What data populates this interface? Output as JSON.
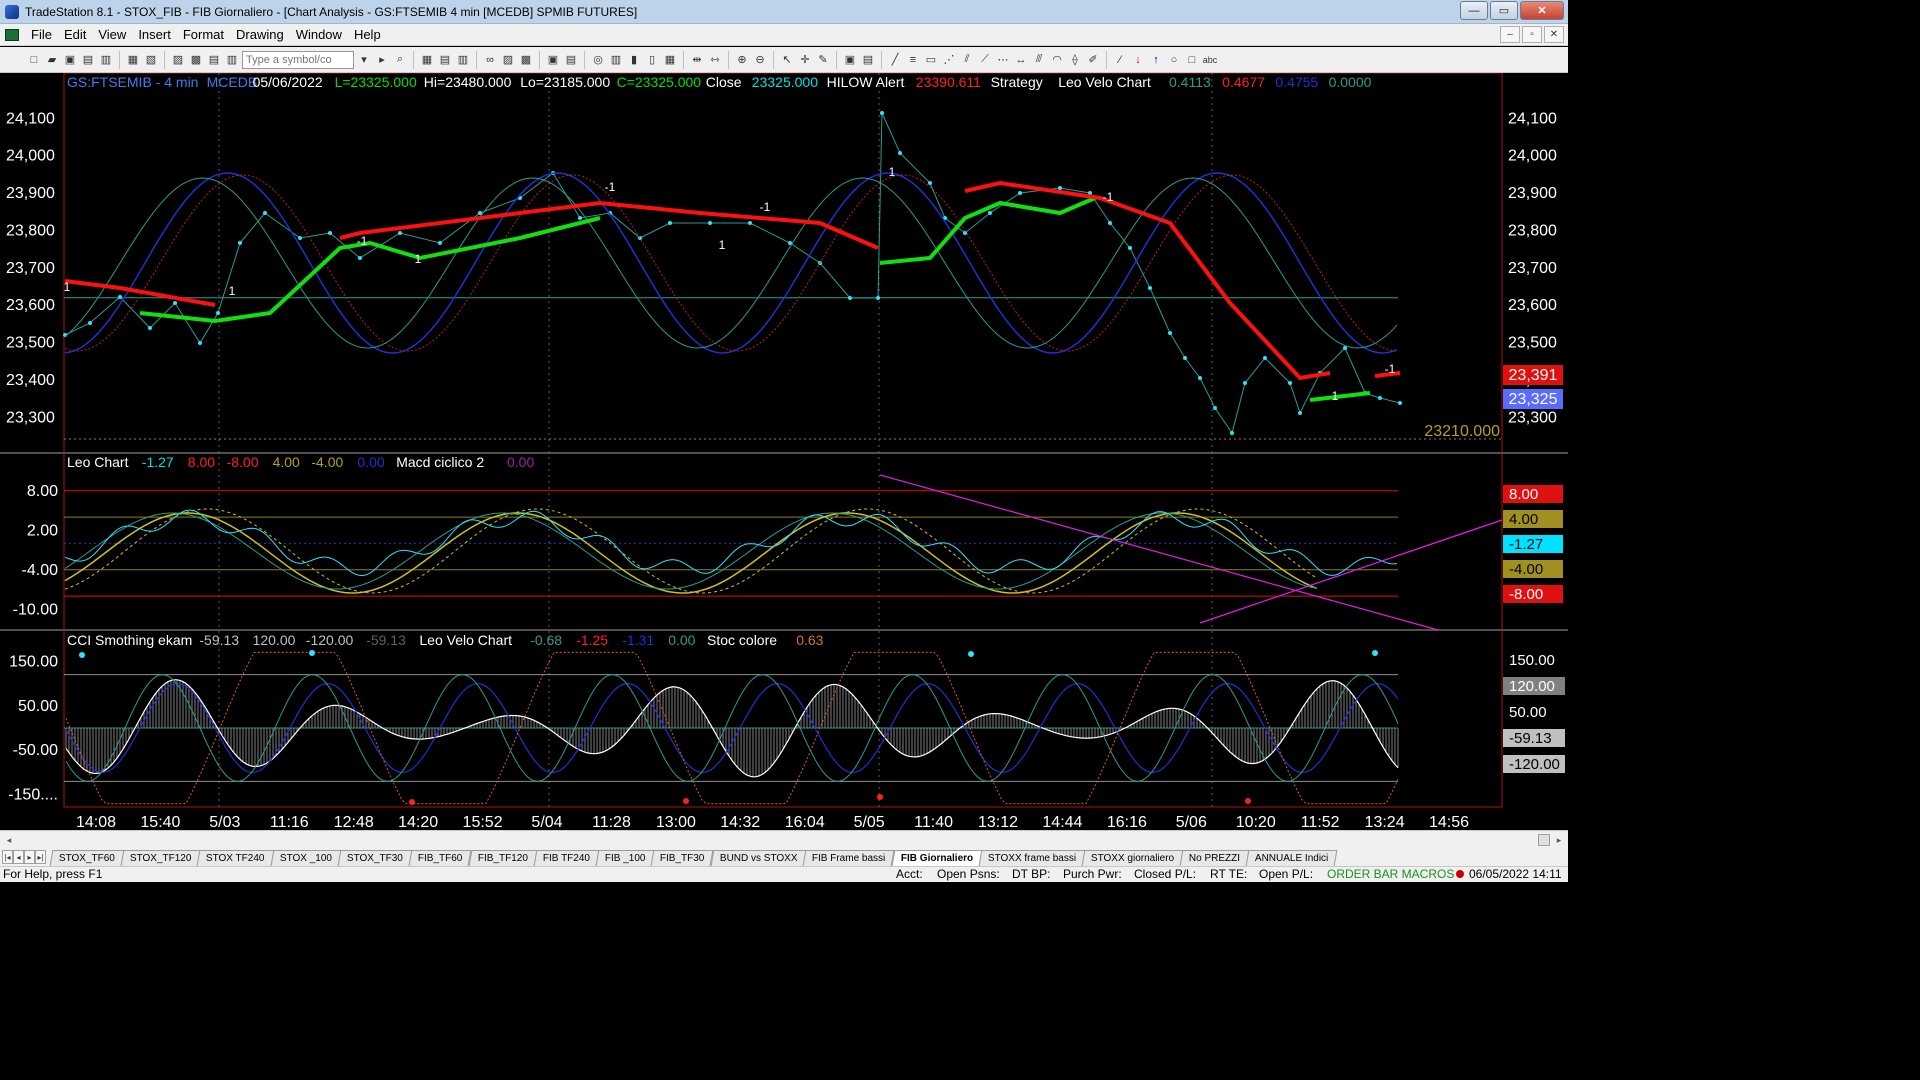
{
  "window": {
    "title": "TradeStation 8.1 - STOX_FIB - FIB Giornaliero - [Chart Analysis - GS:FTSEMIB  4 min  [MCEDB] SPMIB FUTURES]",
    "minimize": "—",
    "maximize": "▭",
    "close": "✕"
  },
  "menu": {
    "items": [
      "File",
      "Edit",
      "View",
      "Insert",
      "Format",
      "Drawing",
      "Window",
      "Help"
    ]
  },
  "toolbar": {
    "symbol_placeholder": "Type a symbol/co"
  },
  "chart": {
    "price_panel": {
      "header": [
        {
          "text": "GS:FTSEMIB - 4 min",
          "color": "#3d7cf0"
        },
        {
          "text": "MCEDB",
          "color": "#3d7cf0"
        },
        {
          "text": "05/06/2022",
          "color": "#ffffff"
        },
        {
          "text": "L=23325.000",
          "color": "#00e000"
        },
        {
          "text": "Hi=23480.000",
          "color": "#ffffff"
        },
        {
          "text": "Lo=23185.000",
          "color": "#ffffff"
        },
        {
          "text": "C=23325.000",
          "color": "#00e000"
        },
        {
          "text": "Close",
          "color": "#ffffff"
        },
        {
          "text": "23325.000",
          "color": "#00e0e0"
        },
        {
          "text": "HILOW Alert",
          "color": "#ffffff"
        },
        {
          "text": "23390.611",
          "color": "#ff2020"
        },
        {
          "text": "Strategy",
          "color": "#ffffff"
        },
        {
          "text": "Leo Velo Chart",
          "color": "#ffffff"
        },
        {
          "text": "0.4113",
          "color": "#2a9d8f"
        },
        {
          "text": "0.4677",
          "color": "#ff2020"
        },
        {
          "text": "0.4755",
          "color": "#2030d0"
        },
        {
          "text": "0.0000",
          "color": "#2a9d8f"
        }
      ],
      "y_ticks": [
        "24,100",
        "24,000",
        "23,900",
        "23,800",
        "23,700",
        "23,600",
        "23,500",
        "23,400",
        "23,300"
      ],
      "y_tick_values": [
        24100,
        24000,
        23900,
        23800,
        23700,
        23600,
        23500,
        23400,
        23300
      ],
      "ylim": [
        23210,
        24200
      ],
      "level_line": 23620,
      "dotted_level_label": "23210.000",
      "right_labels": [
        {
          "text": "23,391",
          "bg": "#e01010"
        },
        {
          "text": "23,325",
          "bg": "#5a6cff"
        }
      ],
      "signal_labels": [
        "1",
        "1",
        "-1",
        "1",
        "-1",
        "1",
        "-1",
        "1",
        "-1",
        "1",
        "-1"
      ]
    },
    "macd_panel": {
      "header": [
        {
          "text": "Leo Chart",
          "color": "#ffffff"
        },
        {
          "text": "-1.27",
          "color": "#00e0e0"
        },
        {
          "text": "8.00",
          "color": "#ff2020"
        },
        {
          "text": "-8.00",
          "color": "#ff2020"
        },
        {
          "text": "4.00",
          "color": "#b0a020"
        },
        {
          "text": "-4.00",
          "color": "#b0a020"
        },
        {
          "text": "0.00",
          "color": "#2030d0"
        },
        {
          "text": "Macd ciclico 2",
          "color": "#ffffff"
        },
        {
          "text": "0.00",
          "color": "#a020a0"
        }
      ],
      "y_ticks": [
        "8.00",
        "2.00",
        "-4.00",
        "-10.00"
      ],
      "y_tick_values": [
        8,
        2,
        -4,
        -10
      ],
      "ylim": [
        -13,
        11
      ],
      "levels": [
        8,
        4,
        0,
        -4,
        -8
      ],
      "right_labels": [
        {
          "text": "8.00",
          "bg": "#e01010",
          "fg": "#ffffff"
        },
        {
          "text": "4.00",
          "bg": "#a09020",
          "fg": "#000000"
        },
        {
          "text": "-1.27",
          "bg": "#00e0ff",
          "fg": "#000000"
        },
        {
          "text": "-4.00",
          "bg": "#a09020",
          "fg": "#000000"
        },
        {
          "text": "-8.00",
          "bg": "#e01010",
          "fg": "#ffffff"
        }
      ]
    },
    "cci_panel": {
      "header": [
        {
          "text": "CCI Smothing ekam",
          "color": "#ffffff"
        },
        {
          "text": "-59.13",
          "color": "#c0c0c0"
        },
        {
          "text": "120.00",
          "color": "#c0c0c0"
        },
        {
          "text": "-120.00",
          "color": "#c0c0c0"
        },
        {
          "text": "-59.13",
          "color": "#606060"
        },
        {
          "text": "Leo Velo Chart",
          "color": "#ffffff"
        },
        {
          "text": "-0.68",
          "color": "#2a9d8f"
        },
        {
          "text": "-1.25",
          "color": "#ff2020"
        },
        {
          "text": "-1.31",
          "color": "#2030d0"
        },
        {
          "text": "0.00",
          "color": "#2a9d8f"
        },
        {
          "text": "Stoc colore",
          "color": "#ffffff"
        },
        {
          "text": "0.63",
          "color": "#e07020"
        }
      ],
      "y_ticks": [
        "150.00",
        "50.00",
        "-50.00",
        "-150...."
      ],
      "y_tick_values": [
        150,
        50,
        -50,
        -150
      ],
      "ylim": [
        -180,
        180
      ],
      "levels": [
        120,
        0,
        -120
      ],
      "right_labels": [
        {
          "text": "150.00",
          "bg": "#000000",
          "fg": "#ffffff"
        },
        {
          "text": "120.00",
          "bg": "#808080",
          "fg": "#ffffff"
        },
        {
          "text": "50.00",
          "bg": "#000000",
          "fg": "#ffffff"
        },
        {
          "text": "-59.13",
          "bg": "#c0c0c0",
          "fg": "#000000"
        },
        {
          "text": "-120.00",
          "bg": "#c0c0c0",
          "fg": "#000000"
        }
      ]
    },
    "x_ticks": [
      "14:08",
      "15:40",
      "5/03",
      "11:16",
      "12:48",
      "14:20",
      "15:52",
      "5/04",
      "11:28",
      "13:00",
      "14:32",
      "16:04",
      "5/05",
      "11:40",
      "13:12",
      "14:44",
      "16:16",
      "5/06",
      "10:20",
      "11:52",
      "13:24",
      "14:56"
    ]
  },
  "tabs": [
    "STOX_TF60",
    "STOX_TF120",
    "STOX TF240",
    "STOX _100",
    "STOX_TF30",
    "FIB_TF60",
    "FIB_TF120",
    "FIB TF240",
    "FIB _100",
    "FIB_TF30",
    "BUND vs STOXX",
    "FIB Frame bassi",
    "FIB Giornaliero",
    "STOXX frame bassi",
    "STOXX giornaliero",
    "No PREZZI",
    "ANNUALE Indici"
  ],
  "active_tab": "FIB Giornaliero",
  "status": {
    "help": "For Help, press F1",
    "acct": "Acct:",
    "open_psns": "Open Psns:",
    "dt_bp": "DT BP:",
    "purch_pwr": "Purch Pwr:",
    "closed_pl": "Closed P/L:",
    "rt_te": "RT TE:",
    "open_pl": "Open P/L:",
    "macros": "ORDER BAR  MACROS",
    "datetime": "06/05/2022 14:11"
  }
}
